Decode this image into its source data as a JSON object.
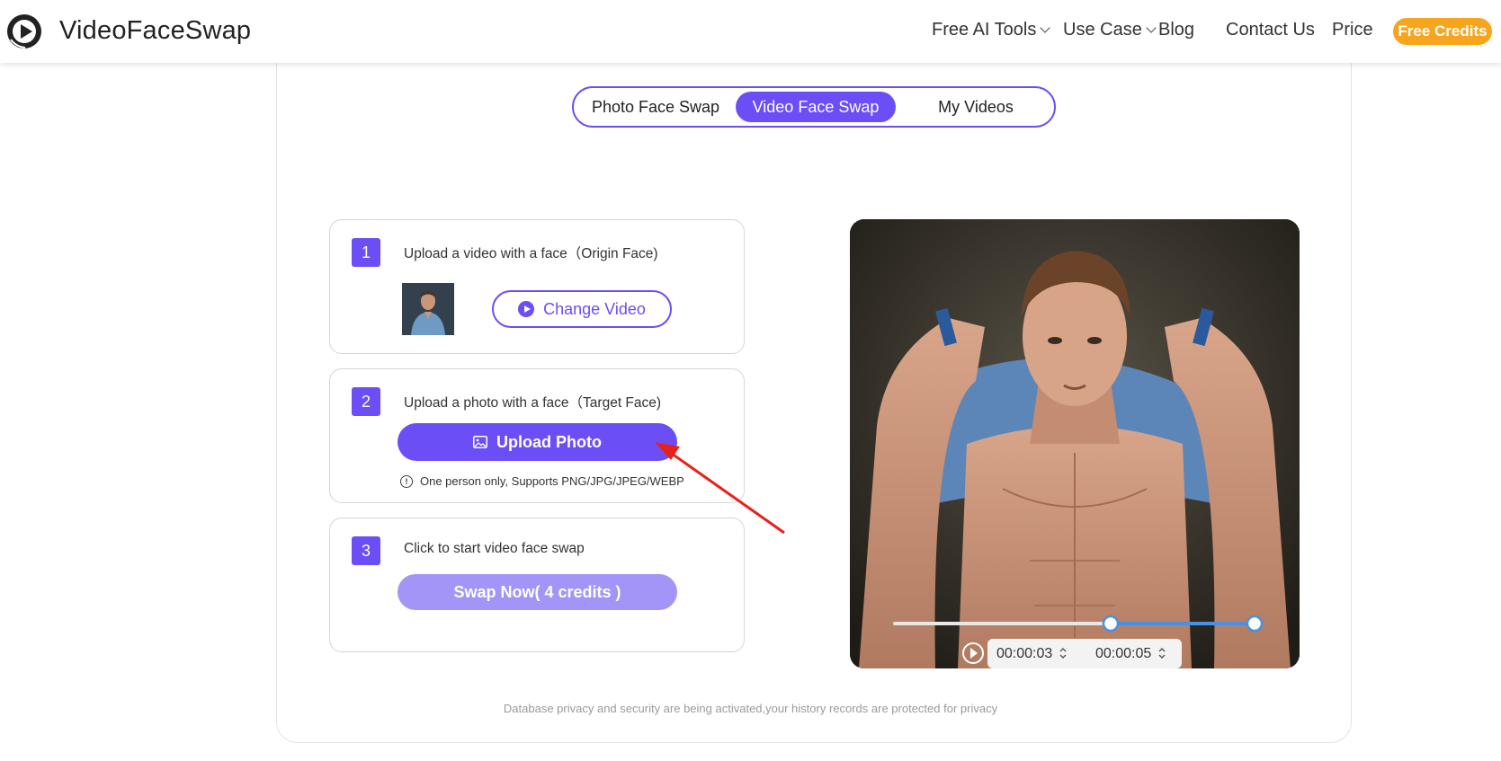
{
  "header": {
    "brand": "VideoFaceSwap",
    "nav": [
      {
        "label": "Free AI Tools",
        "dropdown": true
      },
      {
        "label": "Use Case",
        "dropdown": true
      },
      {
        "label": "Blog",
        "dropdown": false
      },
      {
        "label": "Contact Us",
        "dropdown": false
      },
      {
        "label": "Price",
        "dropdown": false
      }
    ],
    "cta": "Free Credits"
  },
  "tabs": [
    {
      "label": "Photo Face Swap",
      "active": false
    },
    {
      "label": "Video Face Swap",
      "active": true
    },
    {
      "label": "My Videos",
      "active": false
    }
  ],
  "steps": [
    {
      "number": "1",
      "text": "Upload a video with a face（Origin Face)",
      "button": "Change Video"
    },
    {
      "number": "2",
      "text": "Upload a photo with a face（Target Face)",
      "button": "Upload Photo",
      "hint": "One person only, Supports PNG/JPG/JPEG/WEBP"
    },
    {
      "number": "3",
      "text": "Click to start video face swap",
      "button": "Swap Now( 4 credits )"
    }
  ],
  "player": {
    "start_time": "00:00:03",
    "end_time": "00:00:05",
    "trim_start_fraction": 0.6,
    "trim_end_fraction": 1.0
  },
  "footer_note": "Database privacy and security are being activated,your history records are protected for privacy",
  "colors": {
    "accent": "#6b4ef6",
    "accent_disabled": "#a394f8",
    "cta": "#f7a51d",
    "slider": "#4a90e2"
  }
}
